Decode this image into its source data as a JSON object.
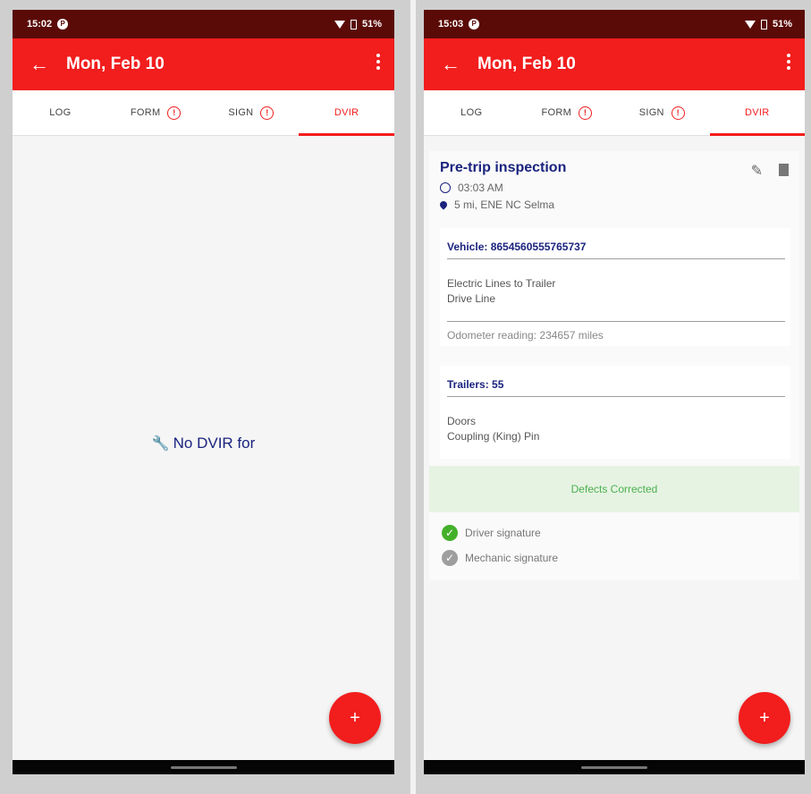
{
  "left": {
    "status": {
      "time": "15:02",
      "battery": "51%"
    },
    "appbar": {
      "title": "Mon, Feb 10"
    },
    "tabs": [
      "LOG",
      "FORM",
      "SIGN",
      "DVIR"
    ],
    "empty": "No DVIR for"
  },
  "right": {
    "status": {
      "time": "15:03",
      "battery": "51%"
    },
    "appbar": {
      "title": "Mon, Feb 10"
    },
    "tabs": [
      "LOG",
      "FORM",
      "SIGN",
      "DVIR"
    ],
    "inspection": {
      "title": "Pre-trip inspection",
      "time": "03:03 AM",
      "location": "5 mi, ENE NC Selma",
      "vehicle": {
        "header": "Vehicle: 8654560555765737",
        "defects": [
          "Electric Lines to Trailer",
          "Drive Line"
        ],
        "odometer": "Odometer reading: 234657 miles"
      },
      "trailers": {
        "header": "Trailers: 55",
        "defects": [
          "Doors",
          "Coupling (King) Pin"
        ]
      },
      "status": "Defects Corrected",
      "signatures": [
        "Driver signature",
        "Mechanic signature"
      ]
    }
  },
  "colors": {
    "primary": "#f21d1d",
    "status_bar": "#5a0b07",
    "title_text": "#1a237e",
    "success": "#4caf50",
    "success_bg": "#e6f3e2"
  },
  "icons": [
    "back-arrow-icon",
    "overflow-menu-icon",
    "alert-icon",
    "wrench-icon",
    "clock-icon",
    "location-pin-icon",
    "pencil-icon",
    "trash-icon",
    "check-circle-icon",
    "plus-icon"
  ]
}
